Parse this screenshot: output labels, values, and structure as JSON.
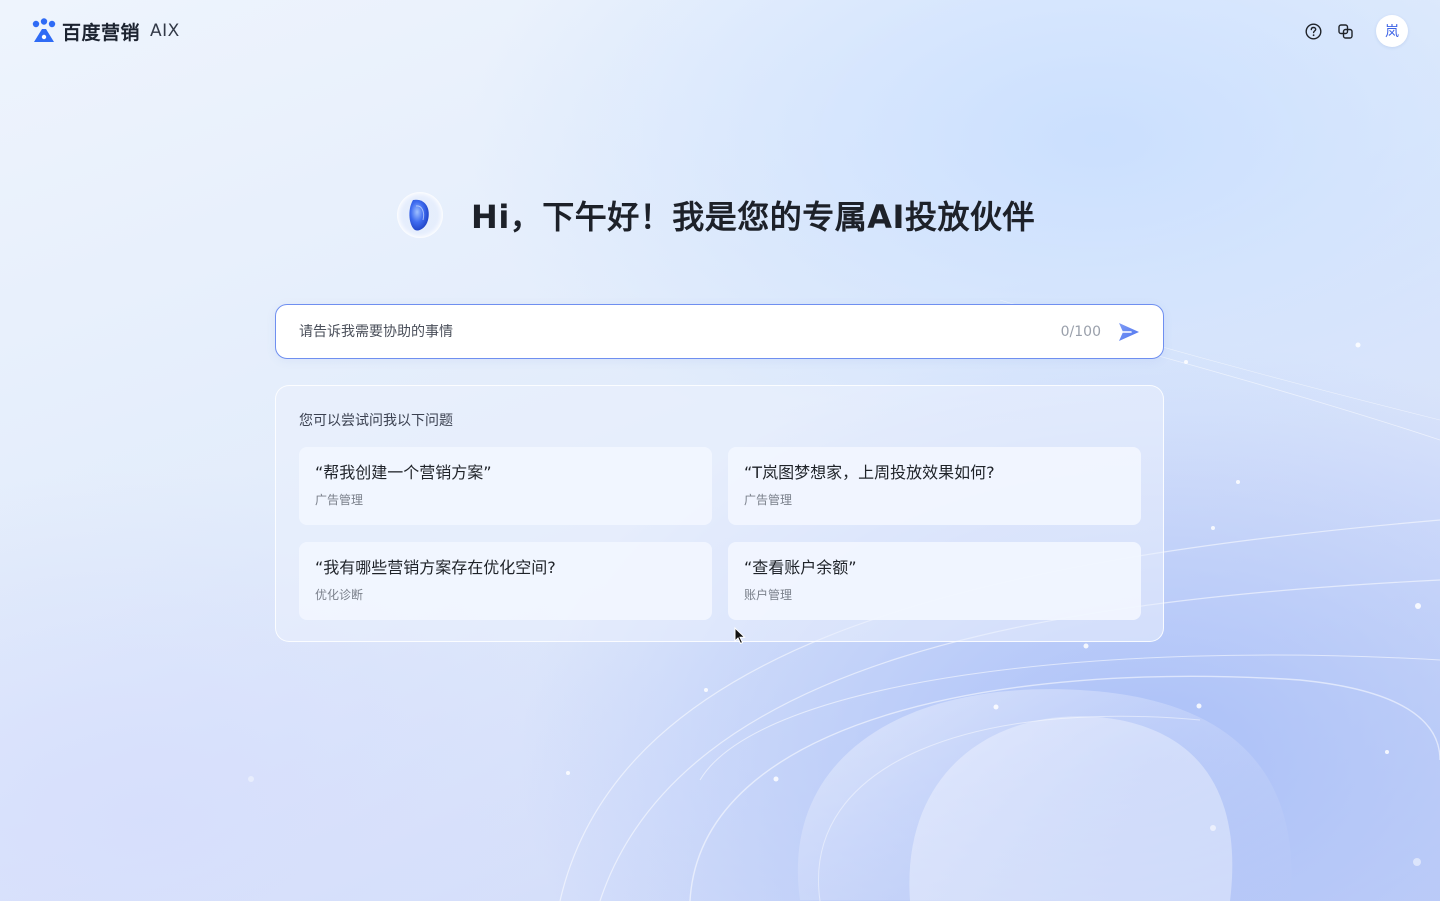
{
  "header": {
    "brand_name": "百度营销",
    "brand_suffix": "AIX",
    "avatar_text": "岚",
    "icons": [
      "help-icon",
      "switch-icon"
    ]
  },
  "greeting": {
    "text": "Hi，下午好！我是您的专属AI投放伙伴"
  },
  "input": {
    "placeholder": "请告诉我需要协助的事情",
    "value": "",
    "counter": "0/100"
  },
  "suggestions": {
    "title": "您可以尝试问我以下问题",
    "items": [
      {
        "question": "“帮我创建一个营销方案”",
        "category": "广告管理"
      },
      {
        "question": "“T岚图梦想家，上周投放效果如何?",
        "category": "广告管理"
      },
      {
        "question": "“我有哪些营销方案存在优化空间?",
        "category": "优化诊断"
      },
      {
        "question": "“查看账户余额”",
        "category": "账户管理"
      }
    ]
  },
  "colors": {
    "accent": "#3d63e6",
    "input_border": "#6f8ff0",
    "brand_blue": "#2f6bf5"
  }
}
